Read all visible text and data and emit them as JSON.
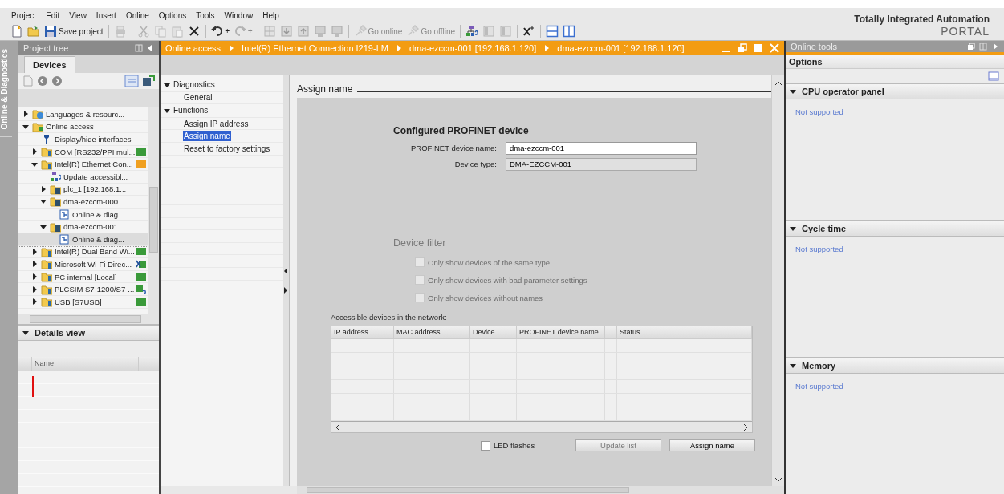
{
  "menu": [
    "Project",
    "Edit",
    "View",
    "Insert",
    "Online",
    "Options",
    "Tools",
    "Window",
    "Help"
  ],
  "toolbar": [
    {
      "kind": "new",
      "disabled": false
    },
    {
      "kind": "open",
      "disabled": false
    },
    {
      "kind": "save",
      "label": "Save project",
      "disabled": false
    },
    {
      "kind": "separator"
    },
    {
      "kind": "print",
      "disabled": true
    },
    {
      "kind": "separator"
    },
    {
      "kind": "cut",
      "disabled": true
    },
    {
      "kind": "copy",
      "disabled": true
    },
    {
      "kind": "paste",
      "disabled": true
    },
    {
      "kind": "delete",
      "disabled": false
    },
    {
      "kind": "separator"
    },
    {
      "kind": "undo",
      "label": "±",
      "disabled": false
    },
    {
      "kind": "redo",
      "label": "±",
      "disabled": true
    },
    {
      "kind": "separator"
    },
    {
      "kind": "grid",
      "disabled": true
    },
    {
      "kind": "download",
      "disabled": true
    },
    {
      "kind": "upload",
      "disabled": true
    },
    {
      "kind": "monitor",
      "disabled": true
    },
    {
      "kind": "monitor",
      "disabled": true
    },
    {
      "kind": "separator"
    },
    {
      "kind": "plug",
      "label": "Go online",
      "disabled": true
    },
    {
      "kind": "plug",
      "label": "Go offline",
      "disabled": true
    },
    {
      "kind": "separator"
    },
    {
      "kind": "accessible",
      "disabled": false
    },
    {
      "kind": "panel",
      "disabled": true
    },
    {
      "kind": "panel",
      "disabled": true
    },
    {
      "kind": "separator"
    },
    {
      "kind": "crossref",
      "disabled": false
    },
    {
      "kind": "separator"
    },
    {
      "kind": "splith",
      "disabled": false
    },
    {
      "kind": "splitv",
      "disabled": false
    }
  ],
  "brand": {
    "title": "Totally Integrated Automation",
    "subtitle": "PORTAL"
  },
  "side_tab": {
    "label": "Online & Diagnostics"
  },
  "project_tree": {
    "title": "Project tree",
    "tab": "Devices",
    "items": [
      {
        "label": "Languages & resourc...",
        "kind": "globe",
        "expanded": false,
        "selected": false
      },
      {
        "label": "Online access",
        "kind": "folder",
        "expanded": true,
        "selected": false,
        "children": [
          {
            "label": "Display/hide interfaces",
            "kind": "wrench",
            "selected": false
          },
          {
            "label": "COM [RS232/PPI mul...",
            "kind": "interface",
            "expanded": false,
            "selected": false,
            "status": {
              "kind": "connected",
              "color": "#3a9a3a"
            }
          },
          {
            "label": "Intel(R) Ethernet Con...",
            "kind": "interface",
            "expanded": true,
            "selected": false,
            "status": {
              "kind": "connected",
              "color": "#f0a020"
            },
            "children": [
              {
                "label": "Update accessibl...",
                "kind": "update",
                "selected": false
              },
              {
                "label": "plc_1 [192.168.1...",
                "kind": "device",
                "expanded": false,
                "selected": false
              },
              {
                "label": "dma-ezccm-000 ...",
                "kind": "device",
                "expanded": true,
                "selected": false,
                "children": [
                  {
                    "label": "Online & diag...",
                    "kind": "diag",
                    "selected": false
                  }
                ]
              },
              {
                "label": "dma-ezccm-001 ...",
                "kind": "device",
                "expanded": true,
                "selected": false,
                "children": [
                  {
                    "label": "Online & diag...",
                    "kind": "diag",
                    "selected": true
                  }
                ]
              }
            ]
          },
          {
            "label": "Intel(R) Dual Band Wi...",
            "kind": "interface",
            "expanded": false,
            "selected": false,
            "status": {
              "kind": "connected",
              "color": "#3a9a3a"
            }
          },
          {
            "label": "Microsoft Wi-Fi Direc...",
            "kind": "interface",
            "expanded": false,
            "selected": false,
            "status": {
              "kind": "disconnected",
              "color": "#3a9a3a"
            }
          },
          {
            "label": "PC internal [Local]",
            "kind": "interface",
            "expanded": false,
            "selected": false,
            "status": {
              "kind": "connected",
              "color": "#3a9a3a"
            }
          },
          {
            "label": "PLCSIM S7-1200/S7-...",
            "kind": "interface",
            "expanded": false,
            "selected": false,
            "status": {
              "kind": "unknown",
              "color": "#3a9a3a"
            }
          },
          {
            "label": "USB [S7USB]",
            "kind": "interface",
            "expanded": false,
            "selected": false,
            "status": {
              "kind": "connected",
              "color": "#3a9a3a"
            }
          }
        ]
      }
    ]
  },
  "details_view": {
    "title": "Details view",
    "expanded": true,
    "columns": [
      "Name"
    ]
  },
  "editor": {
    "breadcrumb": [
      "Online access",
      "Intel(R) Ethernet Connection I219-LM",
      "dma-ezccm-001 [192.168.1.120]",
      "dma-ezccm-001 [192.168.1.120]"
    ],
    "nav": [
      {
        "label": "Diagnostics",
        "expanded": true,
        "items": [
          {
            "label": "General",
            "selected": false
          }
        ]
      },
      {
        "label": "Functions",
        "expanded": true,
        "items": [
          {
            "label": "Assign IP address",
            "selected": false
          },
          {
            "label": "Assign name",
            "selected": true
          },
          {
            "label": "Reset to factory settings",
            "selected": false
          }
        ]
      }
    ],
    "section_title": "Assign name",
    "configured": {
      "title": "Configured PROFINET device",
      "fields": [
        {
          "label": "PROFINET device name:",
          "value": "dma-ezccm-001",
          "disabled": false
        },
        {
          "label": "Device type:",
          "value": "DMA-EZCCM-001",
          "disabled": true
        }
      ]
    },
    "device_filter": {
      "title": "Device filter",
      "disabled": true,
      "options": [
        {
          "label": "Only show devices of the same type",
          "checked": false,
          "disabled": true
        },
        {
          "label": "Only show devices with bad parameter settings",
          "checked": false,
          "disabled": true
        },
        {
          "label": "Only show devices without names",
          "checked": false,
          "disabled": true
        }
      ]
    },
    "devices_table": {
      "title": "Accessible devices in the network:",
      "columns": [
        "IP address",
        "MAC address",
        "Device",
        "PROFINET device name",
        "",
        "Status"
      ]
    },
    "led_flashes": {
      "label": "LED flashes",
      "checked": false
    },
    "buttons": [
      {
        "label": "Update list",
        "disabled": true
      },
      {
        "label": "Assign name",
        "disabled": false
      }
    ]
  },
  "online_tools": {
    "title": "Online tools",
    "options_title": "Options",
    "sections": [
      {
        "title": "CPU operator panel",
        "expanded": true,
        "text": "Not supported"
      },
      {
        "title": "Cycle time",
        "expanded": true,
        "text": "Not supported"
      },
      {
        "title": "Memory",
        "expanded": true,
        "text": "Not supported"
      }
    ]
  }
}
